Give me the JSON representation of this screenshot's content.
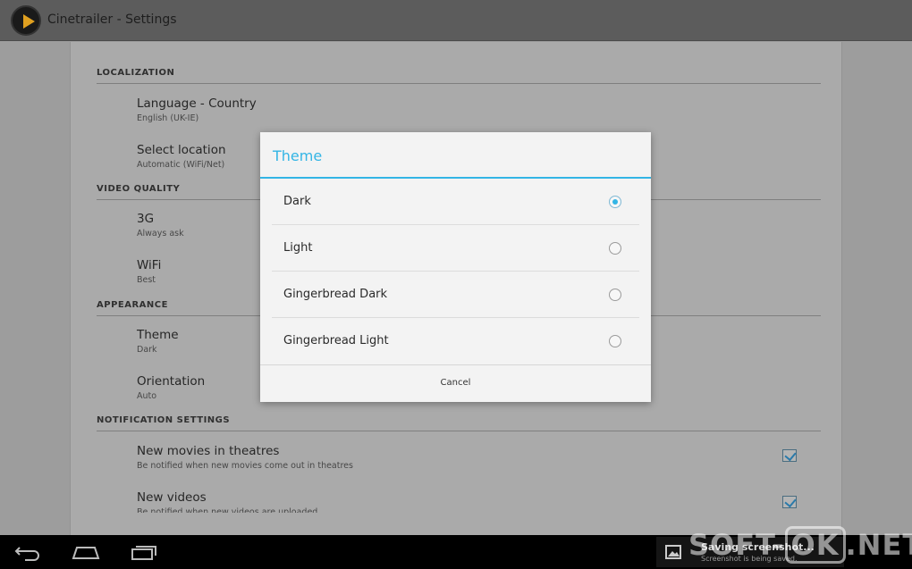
{
  "app": {
    "title": "Cinetrailer - Settings"
  },
  "sections": {
    "localization": "LOCALIZATION",
    "video_quality": "VIDEO QUALITY",
    "appearance": "APPEARANCE",
    "notification": "NOTIFICATION SETTINGS"
  },
  "prefs": {
    "language": {
      "title": "Language - Country",
      "summary": "English (UK-IE)"
    },
    "location": {
      "title": "Select location",
      "summary": "Automatic (WiFi/Net)"
    },
    "q3g": {
      "title": "3G",
      "summary": "Always ask"
    },
    "wifi": {
      "title": "WiFi",
      "summary": "Best"
    },
    "theme": {
      "title": "Theme",
      "summary": "Dark"
    },
    "orientation": {
      "title": "Orientation",
      "summary": "Auto"
    },
    "new_movies": {
      "title": "New movies in theatres",
      "summary": "Be notified when new movies come out in theatres",
      "checked": true
    },
    "new_videos": {
      "title": "New videos",
      "summary": "Be notified when new videos are uploaded",
      "checked": true
    }
  },
  "dialog": {
    "title": "Theme",
    "options": [
      {
        "label": "Dark",
        "selected": true
      },
      {
        "label": "Light",
        "selected": false
      },
      {
        "label": "Gingerbread Dark",
        "selected": false
      },
      {
        "label": "Gingerbread Light",
        "selected": false
      }
    ],
    "cancel": "Cancel"
  },
  "notification": {
    "title": "Saving screenshot...",
    "subtitle": "Screenshot is being saved."
  },
  "watermark": {
    "left": "SOFT-",
    "boxed": "OK",
    "right": ".NET"
  },
  "colors": {
    "accent": "#33b5e5",
    "dim_background": "#9d9d9d",
    "dialog_bg": "#f3f3f3"
  }
}
